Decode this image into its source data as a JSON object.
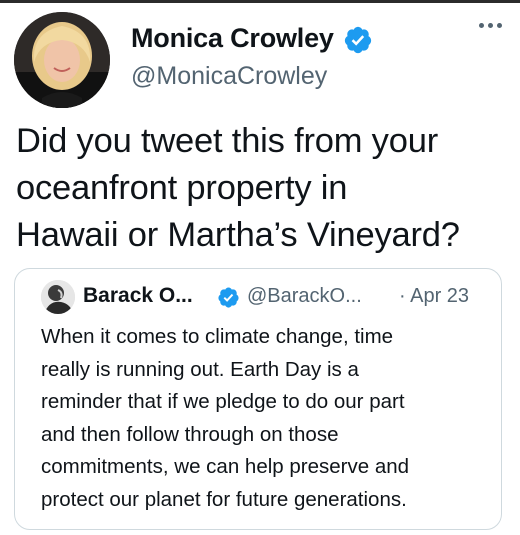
{
  "tweet": {
    "author_name": "Monica Crowley",
    "author_handle": "@MonicaCrowley",
    "verified": true,
    "more_icon": "more-horizontal-icon",
    "text_lines": [
      "Did you tweet this from your",
      "oceanfront property in",
      "Hawaii or Martha’s Vineyard?"
    ]
  },
  "quoted": {
    "author_name": "Barack O...",
    "author_handle": "@BarackO...",
    "date": "· Apr 23",
    "verified": true,
    "text_lines": [
      "When it comes to climate change, time",
      "really is running out. Earth Day is a",
      "reminder that if we pledge to do our part",
      "and then follow through on those",
      "commitments, we can help preserve and",
      "protect our planet for future generations."
    ]
  },
  "colors": {
    "verified_blue": "#1d9bf0",
    "text_primary": "#0f1419",
    "text_secondary": "#536471",
    "border": "#cfd9de"
  }
}
